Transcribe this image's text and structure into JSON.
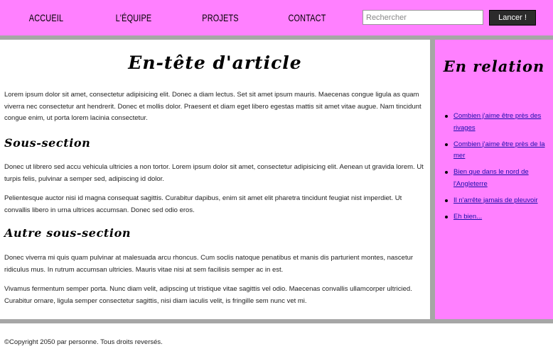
{
  "nav": {
    "links": [
      "ACCUEIL",
      "L'ÉQUIPE",
      "PROJETS",
      "CONTACT"
    ],
    "search_placeholder": "Rechercher",
    "search_button": "Lancer !"
  },
  "article": {
    "title": "En-tête d'article",
    "p1": "Lorem ipsum dolor sit amet, consectetur adipisicing elit. Donec a diam lectus. Set sit amet ipsum mauris. Maecenas congue ligula as quam viverra nec consectetur ant hendrerit. Donec et mollis dolor. Praesent et diam eget libero egestas mattis sit amet vitae augue. Nam tincidunt congue enim, ut porta lorem lacinia consectetur.",
    "h2a": "Sous-section",
    "p2": "Donec ut librero sed accu vehicula ultricies a non tortor. Lorem ipsum dolor sit amet, consectetur adipisicing elit. Aenean ut gravida lorem. Ut turpis felis, pulvinar a semper sed, adipiscing id dolor.",
    "p3": "Pelientesque auctor nisi id magna consequat sagittis. Curabitur dapibus, enim sit amet elit pharetra tincidunt feugiat nist imperdiet. Ut convallis libero in urna ultrices accumsan. Donec sed odio eros.",
    "h2b": "Autre sous-section",
    "p4": "Donec viverra mi quis quam pulvinar at malesuada arcu rhoncus. Cum soclis natoque penatibus et manis dis parturient montes, nascetur ridiculus mus. In rutrum accumsan ultricies. Mauris vitae nisi at sem facilisis semper ac in est.",
    "p5": "Vivamus fermentum semper porta. Nunc diam velit, adipscing ut tristique vitae sagittis vel odio. Maecenas convallis ullamcorper ultricied. Curabitur ornare, ligula semper consectetur sagittis, nisi diam iaculis velit, is fringille sem nunc vet mi."
  },
  "aside": {
    "title": "En relation",
    "links": [
      "Combien j'aime être près des rivages",
      "Combien j'aime être près de la mer",
      "Bien que dans le nord de l'Angleterre",
      "Il n'arrête jamais de pleuvoir",
      "Eh bien..."
    ]
  },
  "footer": {
    "text": "©Copyright 2050 par personne. Tous droits reversés."
  },
  "colors": {
    "accent": "#ff80ff",
    "background": "#a6a6a6",
    "button": "#2b2b2b",
    "link": "#1a0dab"
  }
}
